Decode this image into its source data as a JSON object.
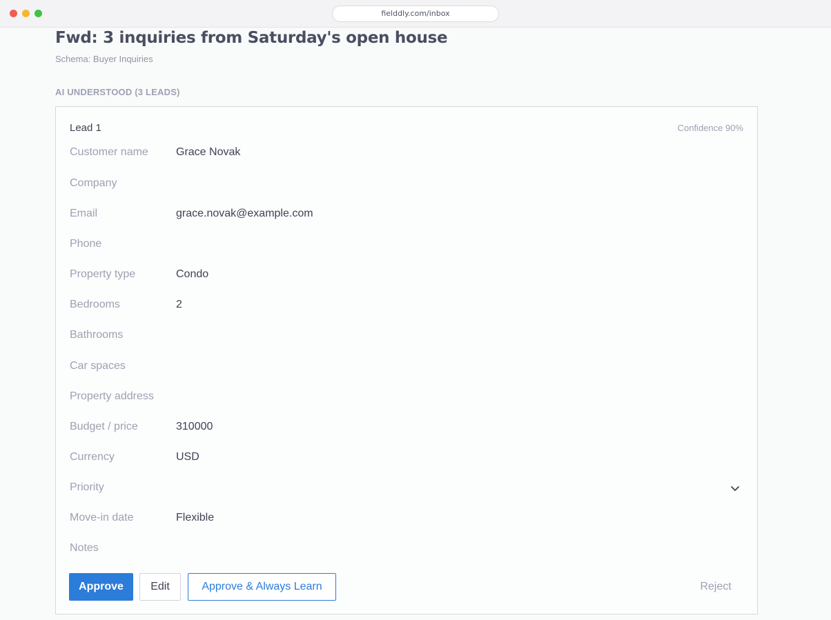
{
  "browser": {
    "url": "fielddly.com/inbox"
  },
  "page": {
    "title": "Fwd: 3 inquiries from Saturday's open house",
    "schema": "Schema: Buyer Inquiries",
    "section_label": "AI UNDERSTOOD (3 LEADS)"
  },
  "lead": {
    "title": "Lead 1",
    "confidence": "Confidence 90%",
    "fields": [
      {
        "label": "Customer name",
        "value": "Grace Novak"
      },
      {
        "label": "Company",
        "value": ""
      },
      {
        "label": "Email",
        "value": "grace.novak@example.com"
      },
      {
        "label": "Phone",
        "value": ""
      },
      {
        "label": "Property type",
        "value": "Condo"
      },
      {
        "label": "Bedrooms",
        "value": "2"
      },
      {
        "label": "Bathrooms",
        "value": ""
      },
      {
        "label": "Car spaces",
        "value": ""
      },
      {
        "label": "Property address",
        "value": ""
      },
      {
        "label": "Budget / price",
        "value": "310000"
      },
      {
        "label": "Currency",
        "value": "USD"
      },
      {
        "label": "Priority",
        "value": "",
        "icon": "chevron-down-icon"
      },
      {
        "label": "Move-in date",
        "value": "Flexible"
      },
      {
        "label": "Notes",
        "value": ""
      }
    ]
  },
  "actions": {
    "approve": "Approve",
    "edit": "Edit",
    "approve_learn": "Approve & Always Learn",
    "reject": "Reject"
  },
  "colors": {
    "accent": "#2c7cd9",
    "muted": "#9da1b1",
    "text": "#3e4254"
  }
}
